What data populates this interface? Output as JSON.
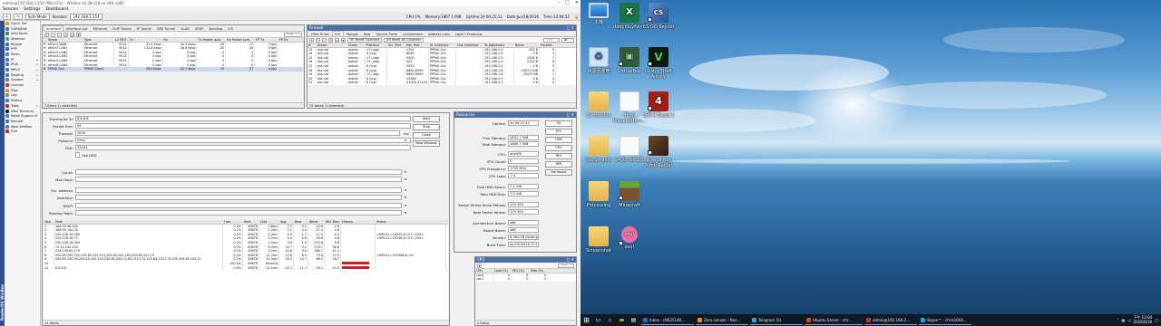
{
  "winbox": {
    "title": "admin@192.168.2.254 (MikroTik) - WinBox v6.36rc28 on x86 (x86)",
    "menu": [
      "Session",
      "Settings",
      "Dashboard"
    ],
    "toolbar": {
      "safe_mode": "Safe Mode",
      "session_label": "Session:",
      "session_value": "192.168.2.254"
    },
    "status_right": {
      "cpu": "CPU:1%",
      "memory": "Memory:1867.1 MiB",
      "uptime": "Uptime:2d 00:21:12",
      "date": "Date:Jun/18/2016",
      "time": "Time:12:04:52"
    },
    "vertical_brand": "RouterOS WinBox",
    "sidebar": [
      {
        "label": "Quick Set",
        "color": "#d89a2a",
        "arrow": false
      },
      {
        "label": "CAPsMAN",
        "color": "#4a79c0",
        "arrow": false
      },
      {
        "label": "Interfaces",
        "color": "#3f8f3f",
        "arrow": false
      },
      {
        "label": "Wireless",
        "color": "#5a8fd0",
        "arrow": false
      },
      {
        "label": "Bridge",
        "color": "#2f6fb7",
        "arrow": false
      },
      {
        "label": "PPP",
        "color": "#2f6fb7",
        "arrow": false
      },
      {
        "label": "Mesh",
        "color": "#4a79c0",
        "arrow": false
      },
      {
        "label": "IP",
        "color": "#4a79c0",
        "arrow": true
      },
      {
        "label": "IPv6",
        "color": "#4a79c0",
        "arrow": true
      },
      {
        "label": "MPLS",
        "color": "#4a79c0",
        "arrow": true
      },
      {
        "label": "Routing",
        "color": "#4a79c0",
        "arrow": true
      },
      {
        "label": "System",
        "color": "#777777",
        "arrow": true
      },
      {
        "label": "Queues",
        "color": "#c0392b",
        "arrow": false
      },
      {
        "label": "Files",
        "color": "#d89a2a",
        "arrow": false
      },
      {
        "label": "Log",
        "color": "#888888",
        "arrow": false
      },
      {
        "label": "Radius",
        "color": "#3a7bd5",
        "arrow": false
      },
      {
        "label": "Tools",
        "color": "#b03030",
        "arrow": true
      },
      {
        "label": "New Terminal",
        "color": "#222222",
        "arrow": false
      },
      {
        "label": "Make Supout.rif",
        "color": "#4a79c0",
        "arrow": false
      },
      {
        "label": "Manual",
        "color": "#3a7bd5",
        "arrow": false
      },
      {
        "label": "New WinBox",
        "color": "#4a79c0",
        "arrow": false
      },
      {
        "label": "Exit",
        "color": "#b03030",
        "arrow": false
      }
    ],
    "interface_window": {
      "tabs": [
        "Interface",
        "Interface List",
        "Ethernet",
        "EoIP Tunnel",
        "IP Tunnel",
        "GRE Tunnel",
        "VLAN",
        "VRRP",
        "Bonding",
        "LTE"
      ],
      "find_placeholder": "Find",
      "columns": [
        "Name",
        "Type",
        "L2 MTU",
        "Tx",
        "Rx",
        "Tx Packet (p/s)",
        "Rx Packet (p/s)",
        "FP Tx",
        "FP Rx"
      ],
      "rows": [
        {
          "flag": "R",
          "name": "ether1-WAN",
          "type": "Ethernet",
          "mtu": "9014",
          "tx": "31.0 kbps",
          "rx": "40.3 kbps",
          "txp": "29",
          "rxp": "27",
          "fptx": "0 bps",
          "fprx": "",
          "sel": false
        },
        {
          "flag": "R",
          "name": "ether2-LAN1",
          "type": "Ethernet",
          "mtu": "9014",
          "tx": "132.6 kbps",
          "rx": "26.6 kbps",
          "txp": "20",
          "rxp": "40",
          "fptx": "0 bps",
          "fprx": "",
          "sel": false
        },
        {
          "flag": "R",
          "name": "ether3-LAN2",
          "type": "Ethernet",
          "mtu": "9014",
          "tx": "0 bps",
          "rx": "0 bps",
          "txp": "0",
          "rxp": "0",
          "fptx": "0 bps",
          "fprx": "",
          "sel": false
        },
        {
          "flag": "R",
          "name": "ether4-LAN3",
          "type": "Ethernet",
          "mtu": "9014",
          "tx": "0 bps",
          "rx": "0 bps",
          "txp": "0",
          "rxp": "0",
          "fptx": "0 bps",
          "fprx": "",
          "sel": false
        },
        {
          "flag": "R",
          "name": "ether5-LAN4",
          "type": "Ethernet",
          "mtu": "9014",
          "tx": "0 bps",
          "rx": "0 bps",
          "txp": "0",
          "rxp": "0",
          "fptx": "0 bps",
          "fprx": "",
          "sel": false
        },
        {
          "flag": "R",
          "name": "ether6-LAN5",
          "type": "Ethernet",
          "mtu": "9014",
          "tx": "0 bps",
          "rx": "0 bps",
          "txp": "0",
          "rxp": "0",
          "fptx": "0 bps",
          "fprx": "",
          "sel": false
        },
        {
          "flag": "R",
          "name": "PPPoE-Out",
          "type": "PPPoE Client",
          "mtu": "",
          "tx": "26.0 kbps",
          "rx": "42.7 kbps",
          "txp": "29",
          "rxp": "27",
          "fptx": "0 bps",
          "fprx": "",
          "sel": true
        }
      ],
      "status": "7 items (1 selected)"
    },
    "firewall_window": {
      "title": "Firewall",
      "tabs": [
        "Filter Rules",
        "NAT",
        "Mangle",
        "Raw",
        "Service Ports",
        "Connections",
        "Address Lists",
        "Layer7 Protocols"
      ],
      "reset_counters": "Reset Counters",
      "reset_all_counters": "Reset All Counters",
      "find_placeholder": "Find",
      "filter_value": "all",
      "columns": [
        "#",
        "Action",
        "Chain",
        "Protocol",
        "Src. Port",
        "Dst. Port",
        "In. Interface",
        "Out. Interface",
        "To Addresses",
        "Bytes",
        "Packets"
      ],
      "rows": [
        {
          "n": "13",
          "action": "dst-nat",
          "chain": "dstnat",
          "proto": "17 (udp)",
          "sport": "",
          "dport": "1701",
          "inif": "PPPoE-Out",
          "outif": "",
          "to": "192.168.2.4",
          "bytes": "425 B",
          "pkts": "5"
        },
        {
          "n": "14",
          "action": "dst-nat",
          "chain": "dstnat",
          "proto": "6 (tcp)",
          "sport": "",
          "dport": "8080",
          "inif": "PPPoE-Out",
          "outif": "",
          "to": "192.168.2.4",
          "bytes": "0 B",
          "pkts": "0"
        },
        {
          "n": "15",
          "action": "dst-nat",
          "chain": "dstnat",
          "proto": "17 (udp)",
          "sport": "",
          "dport": "4500",
          "inif": "PPPoE-Out",
          "outif": "",
          "to": "192.168.2.4",
          "bytes": "2528 B",
          "pkts": "7"
        },
        {
          "n": "16",
          "action": "dst-nat",
          "chain": "dstnat",
          "proto": "17 (udp)",
          "sport": "",
          "dport": "500",
          "inif": "PPPoE-Out",
          "outif": "",
          "to": "192.168.2.4",
          "bytes": "2720 B",
          "pkts": "8"
        },
        {
          "n": "17",
          "action": "dst-nat",
          "chain": "dstnat",
          "proto": "6 (tcp)",
          "sport": "",
          "dport": "5555",
          "inif": "PPPoE-Out",
          "outif": "",
          "to": "192.168.2.4",
          "bytes": "0 B",
          "pkts": "0"
        },
        {
          "n": "18",
          "action": "dst-nat",
          "chain": "dstnat",
          "proto": "6 (tcp)",
          "sport": "",
          "dport": "6881-6999",
          "inif": "PPPoE-Out",
          "outif": "",
          "to": "192.168.2.8",
          "bytes": "1007.0 KiB",
          "pkts": "9"
        },
        {
          "n": "19",
          "action": "dst-nat",
          "chain": "dstnat",
          "proto": "17 (udp)",
          "sport": "",
          "dport": "6881-6999",
          "inif": "PPPoE-Out",
          "outif": "",
          "to": "192.168.2.8",
          "bytes": "253.6 KiB",
          "pkts": "1"
        },
        {
          "n": "20",
          "action": "dst-nat",
          "chain": "dstnat",
          "proto": "6 (tcp)",
          "sport": "",
          "dport": "25565",
          "inif": "PPPoE-Out",
          "outif": "",
          "to": "192.168.2.5",
          "bytes": "0 B",
          "pkts": "0"
        },
        {
          "n": "21",
          "action": "dst-nat",
          "chain": "dstnat",
          "proto": "6 (tcp)",
          "sport": "",
          "dport": "41000-41100",
          "inif": "PPPoE-Out",
          "outif": "",
          "to": "192.168.2.5",
          "bytes": "0 B",
          "pkts": "0"
        }
      ],
      "status": "22 items (1 selected)"
    },
    "traceroute_window": {
      "fields": [
        {
          "label": "Traceroute To:",
          "value": "8.8.8.8"
        },
        {
          "label": "Packet Size:",
          "value": "56"
        },
        {
          "label": "Timeout:",
          "value": "1000"
        },
        {
          "label": "Protocol:",
          "value": "icmp"
        },
        {
          "label": "Port:",
          "value": "33434"
        }
      ],
      "timeout_unit": "ms",
      "use_dns": "Use DNS",
      "empty_fields": [
        "Count:",
        "Max Hops:",
        "Src. Address:",
        "Interface:",
        "DSCP:",
        "Routing Table:"
      ],
      "buttons": [
        "Start",
        "Stop",
        "Close",
        "New Window"
      ],
      "columns": [
        "Hop",
        "Host",
        "Loss",
        "Sent",
        "Last",
        "Avg.",
        "Best",
        "Worst",
        "Std. Dev.",
        "History",
        "Status"
      ],
      "rows": [
        {
          "hop": "1",
          "host": "168.95.98.254",
          "loss": "0.0%",
          "sent": "49878",
          "last": "0.8ms",
          "avg": "2.3",
          "best": "0.2",
          "worst": "15.6",
          "std": "2.6",
          "hist": false,
          "status": ""
        },
        {
          "hop": "2",
          "host": "168.95.144.24",
          "loss": "0.2%",
          "sent": "49878",
          "last": "1.2ms",
          "avg": "2.1",
          "best": "0.4",
          "worst": "47.4",
          "std": "4.6",
          "hist": false,
          "status": ""
        },
        {
          "hop": "3",
          "host": "220.128.16.290",
          "loss": "0.2%",
          "sent": "49878",
          "last": "5.3ms",
          "avg": "5.5",
          "best": "1.7",
          "worst": "17.0",
          "std": "6.3",
          "hist": false,
          "status": "<MPLS:L=16205,E=0,T=253>"
        },
        {
          "hop": "4",
          "host": "220.128.16.73",
          "loss": "0.2%",
          "sent": "49878",
          "last": "4.2ms",
          "avg": "4.4",
          "best": "1.8",
          "worst": "26.6",
          "std": "4.6",
          "hist": false,
          "status": "<MPLS:L=16196,E=0,T=253>"
        },
        {
          "hop": "5",
          "host": "220.128.16.093",
          "loss": "0.2%",
          "sent": "49878",
          "last": "1.2ms",
          "avg": "4.8",
          "best": "1.4",
          "worst": "133.8",
          "std": "0.8",
          "hist": false,
          "status": ""
        },
        {
          "hop": "6",
          "host": "72.14.242.254",
          "loss": "0.2%",
          "sent": "49878",
          "last": "6.2ms",
          "avg": "20.7",
          "best": "5.2",
          "worst": "233.7",
          "std": "38.8",
          "hist": false,
          "status": ""
        },
        {
          "hop": "7",
          "host": "216.239.62.179",
          "loss": "0.1%",
          "sent": "49878",
          "last": "9.2ms",
          "avg": "24.8",
          "best": "9.4",
          "worst": "288.7",
          "std": "41.2",
          "hist": false,
          "status": ""
        },
        {
          "hop": "8",
          "host": "209.85.250.225,209.85.252.213,209.85.242.163,209.85.251.19",
          "loss": "0.2%",
          "sent": "49878",
          "last": "11.7ms",
          "avg": "12.6",
          "best": "8.5",
          "worst": "79.4",
          "std": "12.9",
          "hist": false,
          "status": "<MPLS:L=315366,E=4>"
        },
        {
          "hop": "9",
          "host": "209.85.245.58,209.85.250.103,209.85.243.23,64.233.175.215,64.233.175.205,209.85.243.21",
          "loss": "0.2%",
          "sent": "49878",
          "last": "12.0ms",
          "avg": "16.2",
          "best": "10.7",
          "worst": "68.2",
          "std": "16.7",
          "hist": false,
          "status": ""
        },
        {
          "hop": "10",
          "host": "",
          "loss": "100.0%",
          "sent": "49878",
          "last": "timeout",
          "avg": "",
          "best": "",
          "worst": "",
          "std": "",
          "hist": true,
          "status": ""
        },
        {
          "hop": "11",
          "host": "8.8.8.8",
          "loss": "0.0%",
          "sent": "49878",
          "last": "12.1ms",
          "avg": "14.7",
          "best": "11.7",
          "worst": "26.1",
          "std": "14.9",
          "hist": true,
          "status": ""
        }
      ],
      "status": "11 items"
    },
    "resources_window": {
      "title": "Resources",
      "rows": [
        {
          "label": "Uptime:",
          "value": "2d 00:21:12"
        },
        {
          "label": "Free Memory:",
          "value": "1831.1 MiB"
        },
        {
          "label": "Total Memory:",
          "value": "1889.7 MiB"
        },
        {
          "label": "CPU:",
          "value": "Intel(R)"
        },
        {
          "label": "CPU Count:",
          "value": "2"
        },
        {
          "label": "CPU Frequency:",
          "value": "1795 MHz"
        },
        {
          "label": "CPU Load:",
          "value": "1 %"
        },
        {
          "label": "Free HDD Space:",
          "value": "7.2 GiB"
        },
        {
          "label": "Total HDD Size:",
          "value": "7.3 GiB"
        },
        {
          "label": "Sector Writes Since Reboot:",
          "value": "129 394"
        },
        {
          "label": "Total Sector Writes:",
          "value": "129 394"
        },
        {
          "label": "Architecture Name:",
          "value": "x86"
        },
        {
          "label": "Board Name:",
          "value": "x86"
        },
        {
          "label": "Version:",
          "value": "6.36rc28 (testing)"
        },
        {
          "label": "Build Time:",
          "value": "Jun/10/2016 12:12:11"
        }
      ],
      "buttons": [
        "OK",
        "PCI",
        "USB",
        "CPU",
        "IRQ",
        "RPS",
        "Hardware"
      ]
    },
    "cpu_window": {
      "title": "CPU",
      "find_placeholder": "Find",
      "columns": [
        "CPU",
        "Load (%)",
        "IRQ (%)",
        "Disk (%)"
      ],
      "rows": [
        {
          "cpu": "cpu0",
          "load": "0",
          "irq": "0",
          "disk": "0"
        },
        {
          "cpu": "cpu1",
          "load": "0",
          "irq": "0",
          "disk": "0"
        }
      ],
      "status": "2 items"
    }
  },
  "desktop": {
    "icons": [
      {
        "label": "本機",
        "kind": "computer",
        "glyph": "",
        "col": 0,
        "row": 0
      },
      {
        "label": "ddbyhiuyfvvm",
        "kind": "excel",
        "glyph": "X",
        "col": 1,
        "row": 0
      },
      {
        "label": "CS:GO Key.txt",
        "kind": "steam",
        "glyph": "CS",
        "col": 2,
        "row": 0
      },
      {
        "label": "資源回收筒",
        "kind": "recycle",
        "glyph": "♻",
        "col": 0,
        "row": 1
      },
      {
        "label": "VirtualBox",
        "kind": "vbox",
        "glyph": "▣",
        "col": 1,
        "row": 1
      },
      {
        "label": "Grand Theft Auto V",
        "kind": "gta",
        "glyph": "V",
        "col": 2,
        "row": 1
      },
      {
        "label": "Carthesian",
        "kind": "folder",
        "glyph": "",
        "col": 0,
        "row": 2
      },
      {
        "label": "Final Presentation...",
        "kind": "paper",
        "glyph": "",
        "col": 1,
        "row": 2
      },
      {
        "label": "Left 4 Dead 2",
        "kind": "l4d",
        "glyph": "4",
        "col": 2,
        "row": 2
      },
      {
        "label": "Documents",
        "kind": "folder",
        "glyph": "",
        "col": 0,
        "row": 3
      },
      {
        "label": "L4D2 SRCDS",
        "kind": "paper",
        "glyph": "",
        "col": 1,
        "row": 3
      },
      {
        "label": "Rise of the Tomb Raider",
        "kind": "tomb",
        "glyph": "",
        "col": 2,
        "row": 3
      },
      {
        "label": "Processing",
        "kind": "folder",
        "glyph": "",
        "col": 0,
        "row": 4
      },
      {
        "label": "Minecraft",
        "kind": "mc",
        "glyph": "",
        "col": 1,
        "row": 4
      },
      {
        "label": "Screenshot",
        "kind": "folder",
        "glyph": "",
        "col": 0,
        "row": 5
      },
      {
        "label": "osu!",
        "kind": "osu",
        "glyph": "osu!",
        "col": 1,
        "row": 5
      }
    ],
    "taskbar": {
      "tasks": [
        {
          "label": "Inbox - c9625148...",
          "color": "#1e72c8"
        },
        {
          "label": "Zero Lanson - Nov...",
          "color": "#f08a24"
        },
        {
          "label": "Telegram (5)",
          "color": "#2ca5e0"
        },
        {
          "label": "Ubuntu Server - chr...",
          "color": "#dd4814"
        },
        {
          "label": "admin@192.168.2....",
          "color": "#c0392b"
        },
        {
          "label": "Skype™ - chris1004...",
          "color": "#00aff0"
        }
      ],
      "time": "下午 12:04",
      "date": "2016/6/18"
    }
  }
}
